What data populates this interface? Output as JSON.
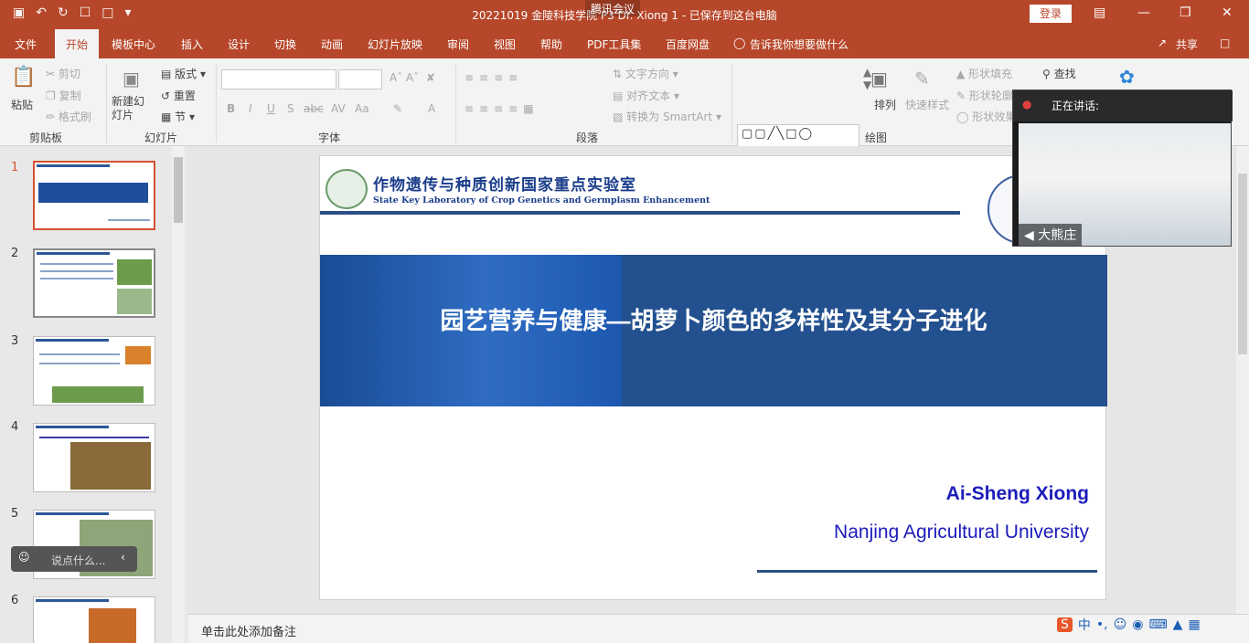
{
  "window": {
    "title": "20221019 金陵科技学院 P3 Dr. Xiong 1 - 已保存到这台电脑",
    "login": "登录",
    "meeting_badge": "腾讯会议"
  },
  "menu": {
    "items": [
      "文件",
      "开始",
      "模板中心",
      "插入",
      "设计",
      "切换",
      "动画",
      "幻灯片放映",
      "审阅",
      "视图",
      "帮助",
      "PDF工具集",
      "百度网盘",
      "告诉我你想要做什么"
    ],
    "share": "共享",
    "comment_icon": "comment-icon"
  },
  "ribbon": {
    "clipboard": {
      "paste": "粘贴",
      "cut": "剪切",
      "copy": "复制",
      "format_painter": "格式刷",
      "group": "剪贴板"
    },
    "slides": {
      "new_slide": "新建幻灯片",
      "layout": "版式",
      "reset": "重置",
      "section": "节",
      "group": "幻灯片"
    },
    "font": {
      "group": "字体",
      "buttons": [
        "B",
        "I",
        "U",
        "S",
        "abc",
        "AV",
        "Aa",
        "A"
      ]
    },
    "paragraph": {
      "group": "段落",
      "text_direction": "文字方向",
      "align_text": "对齐文本",
      "convert_smartart": "转换为 SmartArt"
    },
    "drawing": {
      "group": "绘图",
      "arrange": "排列",
      "quick_styles": "快速样式",
      "shape_fill": "形状填充",
      "shape_outline": "形状轮廓",
      "shape_effects": "形状效果"
    },
    "editing": {
      "find": "查找"
    }
  },
  "thumbnails": [
    {
      "num": "1",
      "selected": true
    },
    {
      "num": "2",
      "selected": false
    },
    {
      "num": "3",
      "selected": false
    },
    {
      "num": "4",
      "selected": false
    },
    {
      "num": "5",
      "selected": false
    },
    {
      "num": "6",
      "selected": false
    }
  ],
  "slide": {
    "header_cn": "作物遗传与种质创新国家重点实验室",
    "header_en": "State Key Laboratory of Crop Genetics and Germplasm Enhancement",
    "title": "园艺营养与健康—胡萝卜颜色的多样性及其分子进化",
    "author": "Ai-Sheng Xiong",
    "university": "Nanjing Agricultural University"
  },
  "notes": {
    "placeholder": "单击此处添加备注"
  },
  "video": {
    "speaking_label": "正在讲话:",
    "speaker_name": "大熊庄"
  },
  "chat": {
    "placeholder": "说点什么..."
  },
  "tray": {
    "ime": "中"
  },
  "colors": {
    "accent": "#b7472a",
    "banner": "#23508f",
    "author": "#1c1cba"
  }
}
